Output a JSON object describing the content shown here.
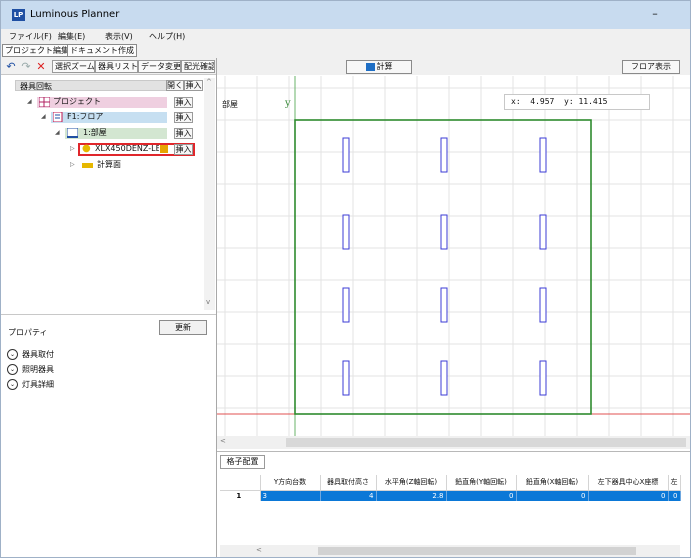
{
  "app": {
    "title": "Luminous Planner",
    "logo": "LP",
    "minimize": "–"
  },
  "menu": [
    "ファイル(F)",
    "編集(E)",
    "表示(V)",
    "ヘルプ(H)"
  ],
  "tabs": [
    "プロジェクト編集",
    "ドキュメント作成"
  ],
  "toolbar": {
    "buttons": [
      "選択ズーム",
      "器具リスト",
      "データ変更",
      "配光確認"
    ],
    "undo_icon": "undo-icon",
    "redo_icon": "redo-icon",
    "delete_icon": "delete-icon"
  },
  "tree": {
    "header": "器具回転",
    "open": "開く",
    "insert": "挿入",
    "items": [
      {
        "label": "プロジェクト",
        "insert": "挿入"
      },
      {
        "label": "F1:フロア",
        "insert": "挿入"
      },
      {
        "label": "1:部屋",
        "insert": "挿入"
      },
      {
        "label": "XLX450DENZ-LE",
        "insert": "挿入"
      },
      {
        "label": "計算面"
      }
    ],
    "highlight_color": "#e0262b"
  },
  "properties": {
    "title": "プロパティ",
    "update": "更新",
    "sections": [
      "器具取付",
      "照明器具",
      "灯具詳細"
    ]
  },
  "view": {
    "calc_button": "計算",
    "floor_button": "フロア表示",
    "room_label": "部屋",
    "y_axis_label": "y",
    "coords": {
      "x_label": "x:",
      "x": "4.957",
      "y_label": "y:",
      "y": "11.415"
    },
    "room_outline_color": "#2e8b2e",
    "fixture_color": "#3b3bd6",
    "fixture_rows": 4,
    "fixture_cols": 3
  },
  "grid": {
    "tab": "格子配置",
    "columns": [
      "",
      "Y方向台数",
      "器具取付高さ",
      "水平角(Z軸回転)",
      "鉛直角(Y軸回転)",
      "鉛直角(X軸回転)",
      "左下器具中心X座標",
      "左"
    ],
    "rows": [
      {
        "num": "1",
        "cells": [
          "3",
          "4",
          "2.8",
          "0",
          "0",
          "0",
          "0"
        ]
      }
    ]
  }
}
